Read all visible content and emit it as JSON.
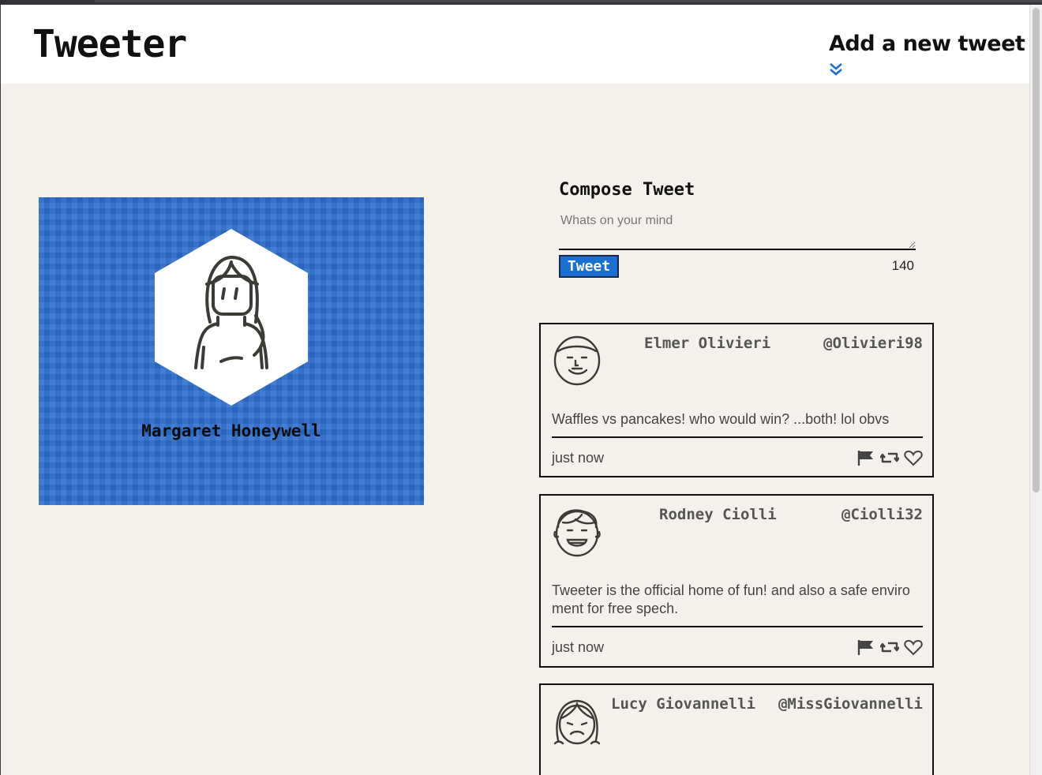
{
  "nav": {
    "brand": "Tweeter",
    "new_tweet_label": "Add a new tweet"
  },
  "profile": {
    "name": "Margaret Honeywell",
    "background_color": "#2e6fd0"
  },
  "compose": {
    "title": "Compose Tweet",
    "placeholder": "Whats on your mind",
    "button_label": "Tweet",
    "counter": "140"
  },
  "tweets": [
    {
      "name": "Elmer Olivieri",
      "handle": "@Olivieri98",
      "text": "Waffles vs pancakes! who would win? ...both! lol obvs",
      "time": "just now",
      "avatar": "man-avatar-icon"
    },
    {
      "name": "Rodney Ciolli",
      "handle": "@Ciolli32",
      "text": "Tweeter is the official home of fun! and also a safe enviro ment for free spech.",
      "time": "just now",
      "avatar": "boy-avatar-icon"
    },
    {
      "name": "Lucy Giovannelli",
      "handle": "@MissGiovannelli",
      "text": "",
      "time": "",
      "avatar": "girl-avatar-icon"
    }
  ],
  "colors": {
    "accent": "#1a6fd2",
    "page_bg": "#f4f1ec",
    "navbar_bg": "#ffffff"
  }
}
